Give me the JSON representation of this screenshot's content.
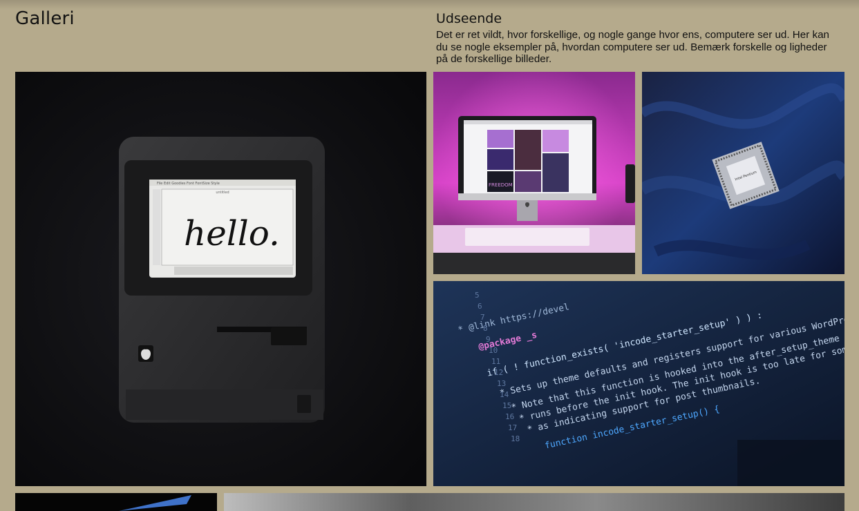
{
  "gallery": {
    "title": "Galleri"
  },
  "section": {
    "title": "Udseende",
    "text": "Det er ret vildt, hvor forskellige, og nogle gange hvor ens, computere ser ud. Her kan du se nogle eksempler på, hvordan computere ser ud. Bemærk forskelle og ligheder på de forskellige billeder."
  },
  "photos": {
    "macintosh": {
      "screen_text": "hello.",
      "menu": "File  Edit  Goodies  Font  FontSize  Style",
      "window_title": "untitled"
    },
    "imac": {
      "poster_text": "FREEDOM"
    },
    "cpu": {
      "label": "Intel Pentium"
    },
    "code": {
      "line1": "* @link https://devel",
      "line2": "@package _s",
      "line3": "if ( ! function_exists( 'incode_starter_setup' ) ) :",
      "line4": "* Sets up theme defaults and registers support for various WordPress features.",
      "line5": "* Note that this function is hooked into the after_setup_theme hook, which",
      "line6": "* runs before the init hook. The init hook is too late for some features, such",
      "line7": "* as indicating support for post thumbnails.",
      "line8": "function incode_starter_setup() {",
      "gutter": [
        "5",
        "6",
        "7",
        "8",
        "9",
        "10",
        "11",
        "12",
        "13",
        "14",
        "15",
        "16",
        "17",
        "18"
      ]
    }
  }
}
